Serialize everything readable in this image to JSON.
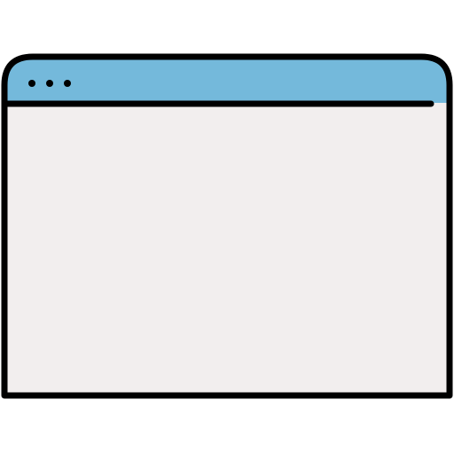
{
  "window": {
    "icon": "browser-window-icon",
    "title_bar": {
      "color": "#74B9DB",
      "controls": [
        {
          "name": "window-control-dot-1"
        },
        {
          "name": "window-control-dot-2"
        },
        {
          "name": "window-control-dot-3"
        }
      ]
    },
    "content_area": {
      "color": "#F2EEEE"
    },
    "outline_color": "#000000"
  }
}
